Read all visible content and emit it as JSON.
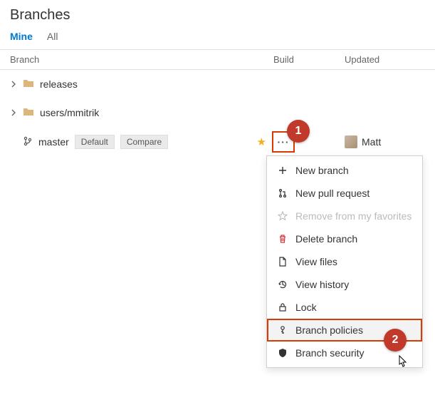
{
  "page": {
    "title": "Branches"
  },
  "tabs": {
    "mine": "Mine",
    "all": "All"
  },
  "columns": {
    "branch": "Branch",
    "build": "Build",
    "updated": "Updated"
  },
  "rows": {
    "releases": {
      "name": "releases"
    },
    "users": {
      "name": "users/mmitrik"
    },
    "master": {
      "name": "master",
      "default_badge": "Default",
      "compare_badge": "Compare",
      "updated_by": "Matt"
    }
  },
  "menu": {
    "new_branch": "New branch",
    "new_pr": "New pull request",
    "remove_fav": "Remove from my favorites",
    "delete": "Delete branch",
    "view_files": "View files",
    "view_history": "View history",
    "lock": "Lock",
    "policies": "Branch policies",
    "security": "Branch security"
  },
  "callouts": {
    "one": "1",
    "two": "2"
  }
}
